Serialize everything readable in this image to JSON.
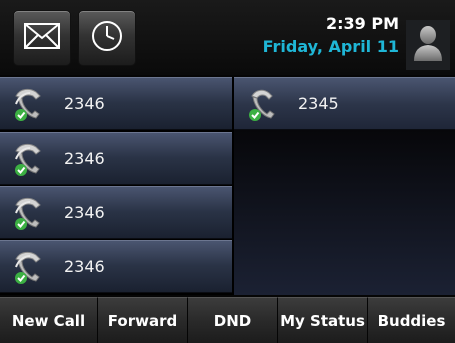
{
  "status_bar": {
    "time": "2:39 PM",
    "date": "Friday, April 11",
    "icons": {
      "messages": "envelope-icon",
      "recents": "clock-icon",
      "avatar": "person-silhouette-icon"
    }
  },
  "lines": [
    {
      "label": "2346",
      "icon": "phone-handset-registered-icon"
    },
    {
      "label": "2346",
      "icon": "phone-handset-registered-icon"
    },
    {
      "label": "2346",
      "icon": "phone-handset-registered-icon"
    },
    {
      "label": "2346",
      "icon": "phone-handset-registered-icon"
    },
    {
      "label": "2345",
      "icon": "phone-handset-registered-icon"
    }
  ],
  "softkeys": [
    "New Call",
    "Forward",
    "DND",
    "My Status",
    "Buddies"
  ],
  "colors": {
    "date_accent": "#1fb6d6",
    "line_key": "#2a3346",
    "registered_check": "#3cb043"
  }
}
